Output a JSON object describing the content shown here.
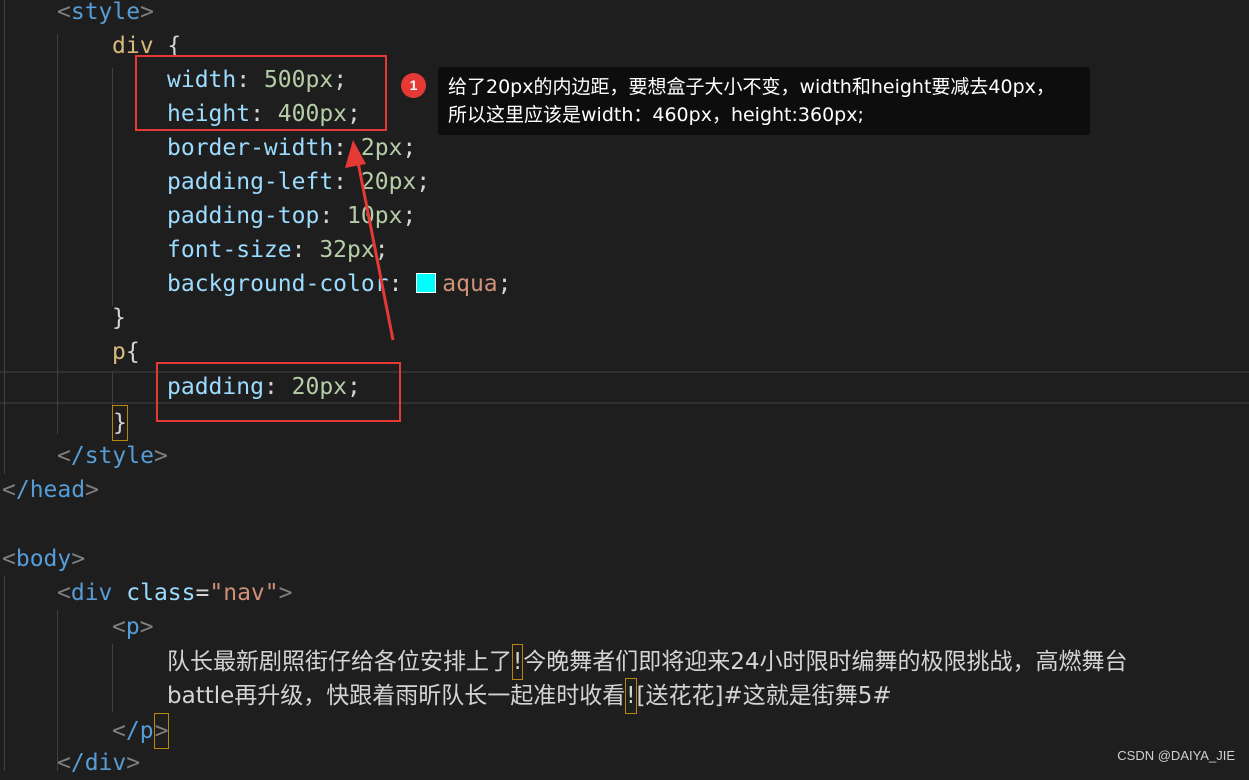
{
  "code": {
    "style_open": "style",
    "div_selector": "div",
    "brace_open": " {",
    "props": [
      {
        "name": "width",
        "value": "500px"
      },
      {
        "name": "height",
        "value": "400px"
      },
      {
        "name": "border-width",
        "value": "2px"
      },
      {
        "name": "padding-left",
        "value": "20px"
      },
      {
        "name": "padding-top",
        "value": "10px"
      },
      {
        "name": "font-size",
        "value": "32px"
      },
      {
        "name": "background-color",
        "value": "aqua"
      }
    ],
    "close_brace": "}",
    "p_selector": "p",
    "p_brace": "{",
    "p_padding_name": "padding",
    "p_padding_value": "20px",
    "style_close": "/style",
    "head_close": "/head",
    "body_open": "body",
    "div_tag": "div",
    "class_attr": "class",
    "class_value": "\"nav\"",
    "p_tag": "p",
    "text_line1_a": "队长最新剧照街仔给各位安排上了",
    "bang": "!",
    "text_line1_b": "今晚舞者们即将迎来24小时限时编舞的极限挑战，高燃舞台",
    "text_line2_a": "battle再升级，快跟着雨昕队长一起准时收看",
    "text_line2_b": "[送花花]#这就是街舞5#",
    "p_close": "/p",
    "div_close": "/div"
  },
  "swatch_color": "#00ffff",
  "annotation": {
    "badge": "1",
    "line1": "给了20px的内边距，要想盒子大小不变，width和height要减去40px，",
    "line2": "所以这里应该是width：460px，height:360px;"
  },
  "watermark": "CSDN @DAIYA_JIE",
  "colors": {
    "highlight_red": "#e53935",
    "editor_bg": "#1e1e1e"
  }
}
